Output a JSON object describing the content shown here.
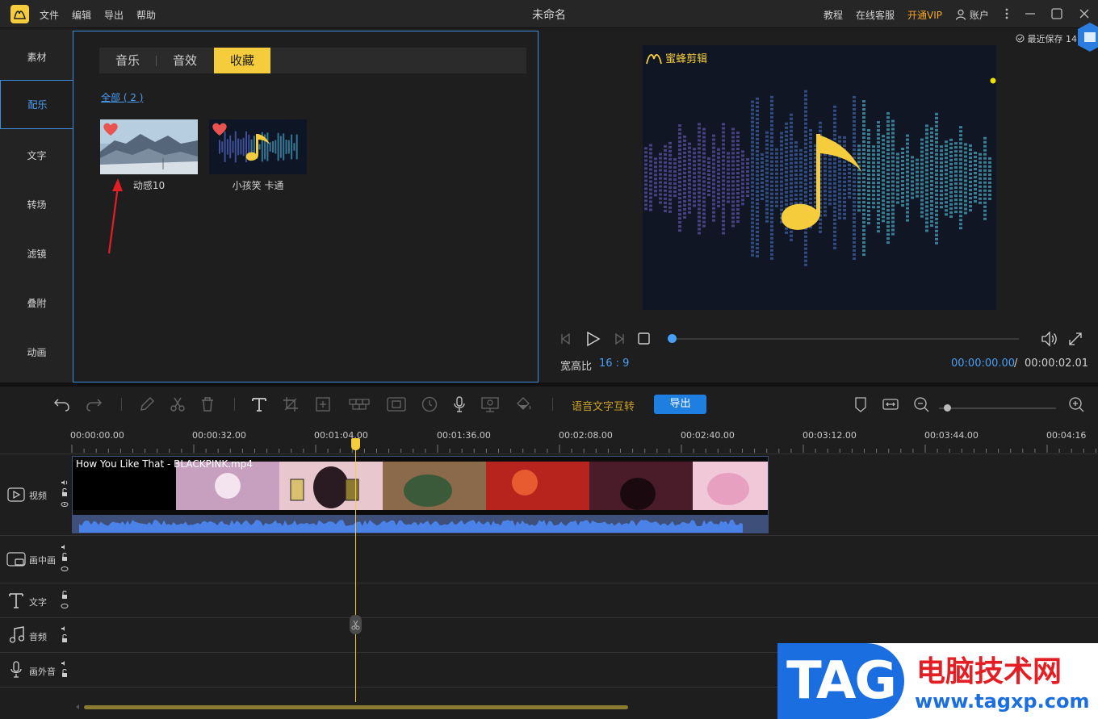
{
  "titlebar": {
    "menu": [
      "文件",
      "编辑",
      "导出",
      "帮助"
    ],
    "doc_title": "未命名",
    "tutorial": "教程",
    "support": "在线客服",
    "vip": "开通VIP",
    "account": "账户"
  },
  "nav": {
    "items": [
      "素材",
      "配乐",
      "文字",
      "转场",
      "滤镜",
      "叠附",
      "动画"
    ],
    "active_index": 1
  },
  "library": {
    "tabs": [
      "音乐",
      "音效",
      "收藏"
    ],
    "active_tab": 2,
    "filter_all": "全部 ( 2 )",
    "items": [
      {
        "name": "动感10",
        "favorited": true
      },
      {
        "name": "小孩笑 卡通",
        "favorited": true
      }
    ]
  },
  "preview": {
    "saved_text": "最近保存 14",
    "brand": "蜜蜂剪辑",
    "aspect_label": "宽高比",
    "aspect_value": "16 : 9",
    "time_current": "00:00:00.00",
    "time_sep": "/",
    "time_total": "00:00:02.01",
    "progress": 0.0
  },
  "toolbar": {
    "speech_text": "语音文字互转",
    "export": "导出"
  },
  "timeline": {
    "ruler_labels": [
      "00:00:00.00",
      "00:00:32.00",
      "00:01:04.00",
      "00:01:36.00",
      "00:02:08.00",
      "00:02:40.00",
      "00:03:12.00",
      "00:03:44.00",
      "00:04:16"
    ],
    "tracks": [
      "视频",
      "画中画",
      "文字",
      "音频",
      "画外音"
    ],
    "clip_title": "How You Like That - BLACKPINK.mp4"
  },
  "watermark": {
    "tag": "TAG",
    "cn": "电脑技术网",
    "url": "www.tagxp.com"
  },
  "colors": {
    "accent_blue": "#4a9ff5",
    "accent_yellow": "#f5cd3c",
    "vip_orange": "#f5a623",
    "export_blue": "#1f7fe0"
  }
}
